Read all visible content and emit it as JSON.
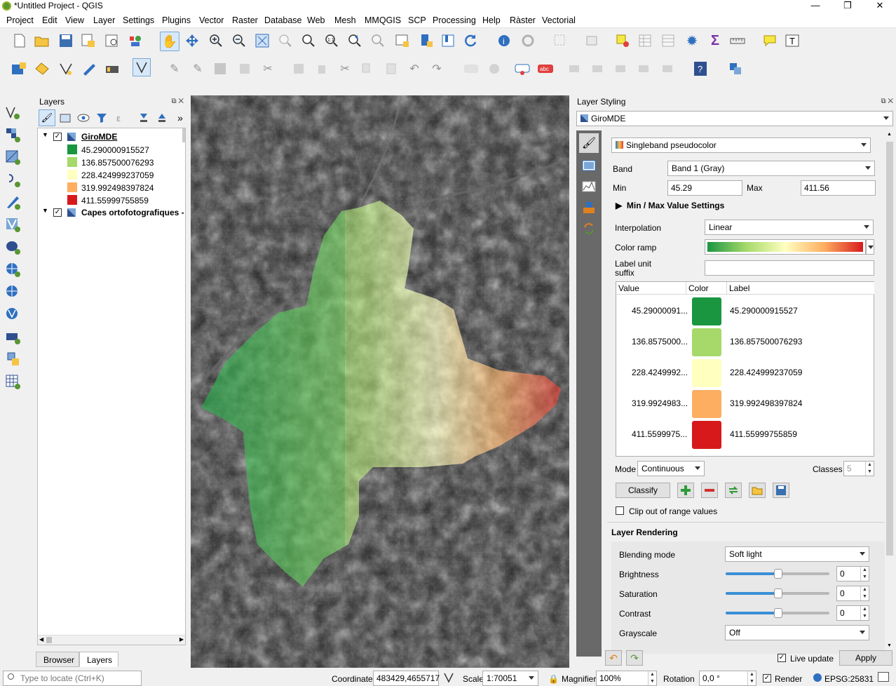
{
  "window": {
    "title": "*Untitled Project - QGIS",
    "min": "—",
    "max": "❐",
    "close": "✕"
  },
  "menu": [
    "Project",
    "Edit",
    "View",
    "Layer",
    "Settings",
    "Plugins",
    "Vector",
    "Raster",
    "Database",
    "Web",
    "Mesh",
    "MMQGIS",
    "SCP",
    "Processing",
    "Help",
    "Ràster",
    "Vectorial"
  ],
  "layers_panel": {
    "title": "Layers",
    "layers": [
      {
        "name": "GiroMDE",
        "checked": true
      },
      {
        "name": "Capes ortofotografiques - ",
        "checked": true
      }
    ],
    "legend": [
      {
        "label": "45.290000915527",
        "color": "#1a9641"
      },
      {
        "label": "136.857500076293",
        "color": "#a6d96a"
      },
      {
        "label": "228.424999237059",
        "color": "#ffffc0"
      },
      {
        "label": "319.992498397824",
        "color": "#fdae61"
      },
      {
        "label": "411.55999755859",
        "color": "#d7191c"
      }
    ],
    "tabs": [
      "Browser",
      "Layers"
    ]
  },
  "styling": {
    "title": "Layer Styling",
    "layer": "GiroMDE",
    "renderer": "Singleband pseudocolor",
    "band_label": "Band",
    "band": "Band 1 (Gray)",
    "min_label": "Min",
    "min": "45.29",
    "max_label": "Max",
    "max": "411.56",
    "minmax_section": "Min / Max Value Settings",
    "interp_label": "Interpolation",
    "interp": "Linear",
    "ramp_label": "Color ramp",
    "suffix_label1": "Label unit",
    "suffix_label2": "suffix",
    "table_headers": [
      "Value",
      "Color",
      "Label"
    ],
    "classes": [
      {
        "value": "45.29000091...",
        "color": "#1a9641",
        "label": "45.290000915527"
      },
      {
        "value": "136.8575000...",
        "color": "#a6d96a",
        "label": "136.857500076293"
      },
      {
        "value": "228.4249992...",
        "color": "#ffffc0",
        "label": "228.424999237059"
      },
      {
        "value": "319.9924983...",
        "color": "#fdae61",
        "label": "319.992498397824"
      },
      {
        "value": "411.5599975...",
        "color": "#d7191c",
        "label": "411.55999755859"
      }
    ],
    "mode_label": "Mode",
    "mode": "Continuous",
    "classes_label": "Classes",
    "classes_count": "5",
    "classify": "Classify",
    "clip_label": "Clip out of range values",
    "rendering_title": "Layer Rendering",
    "blend_label": "Blending mode",
    "blend": "Soft light",
    "brightness_label": "Brightness",
    "brightness": "0",
    "saturation_label": "Saturation",
    "saturation": "0",
    "contrast_label": "Contrast",
    "contrast": "0",
    "grayscale_label": "Grayscale",
    "grayscale": "Off",
    "live_update": "Live update",
    "apply": "Apply"
  },
  "statusbar": {
    "locate_placeholder": "Type to locate (Ctrl+K)",
    "coord_label": "Coordinate",
    "coord": "483429,4655717",
    "scale_label": "Scale",
    "scale": "1:70051",
    "magnifier_label": "Magnifier",
    "magnifier": "100%",
    "rotation_label": "Rotation",
    "rotation": "0,0 °",
    "render_label": "Render",
    "crs": "EPSG:25831"
  }
}
